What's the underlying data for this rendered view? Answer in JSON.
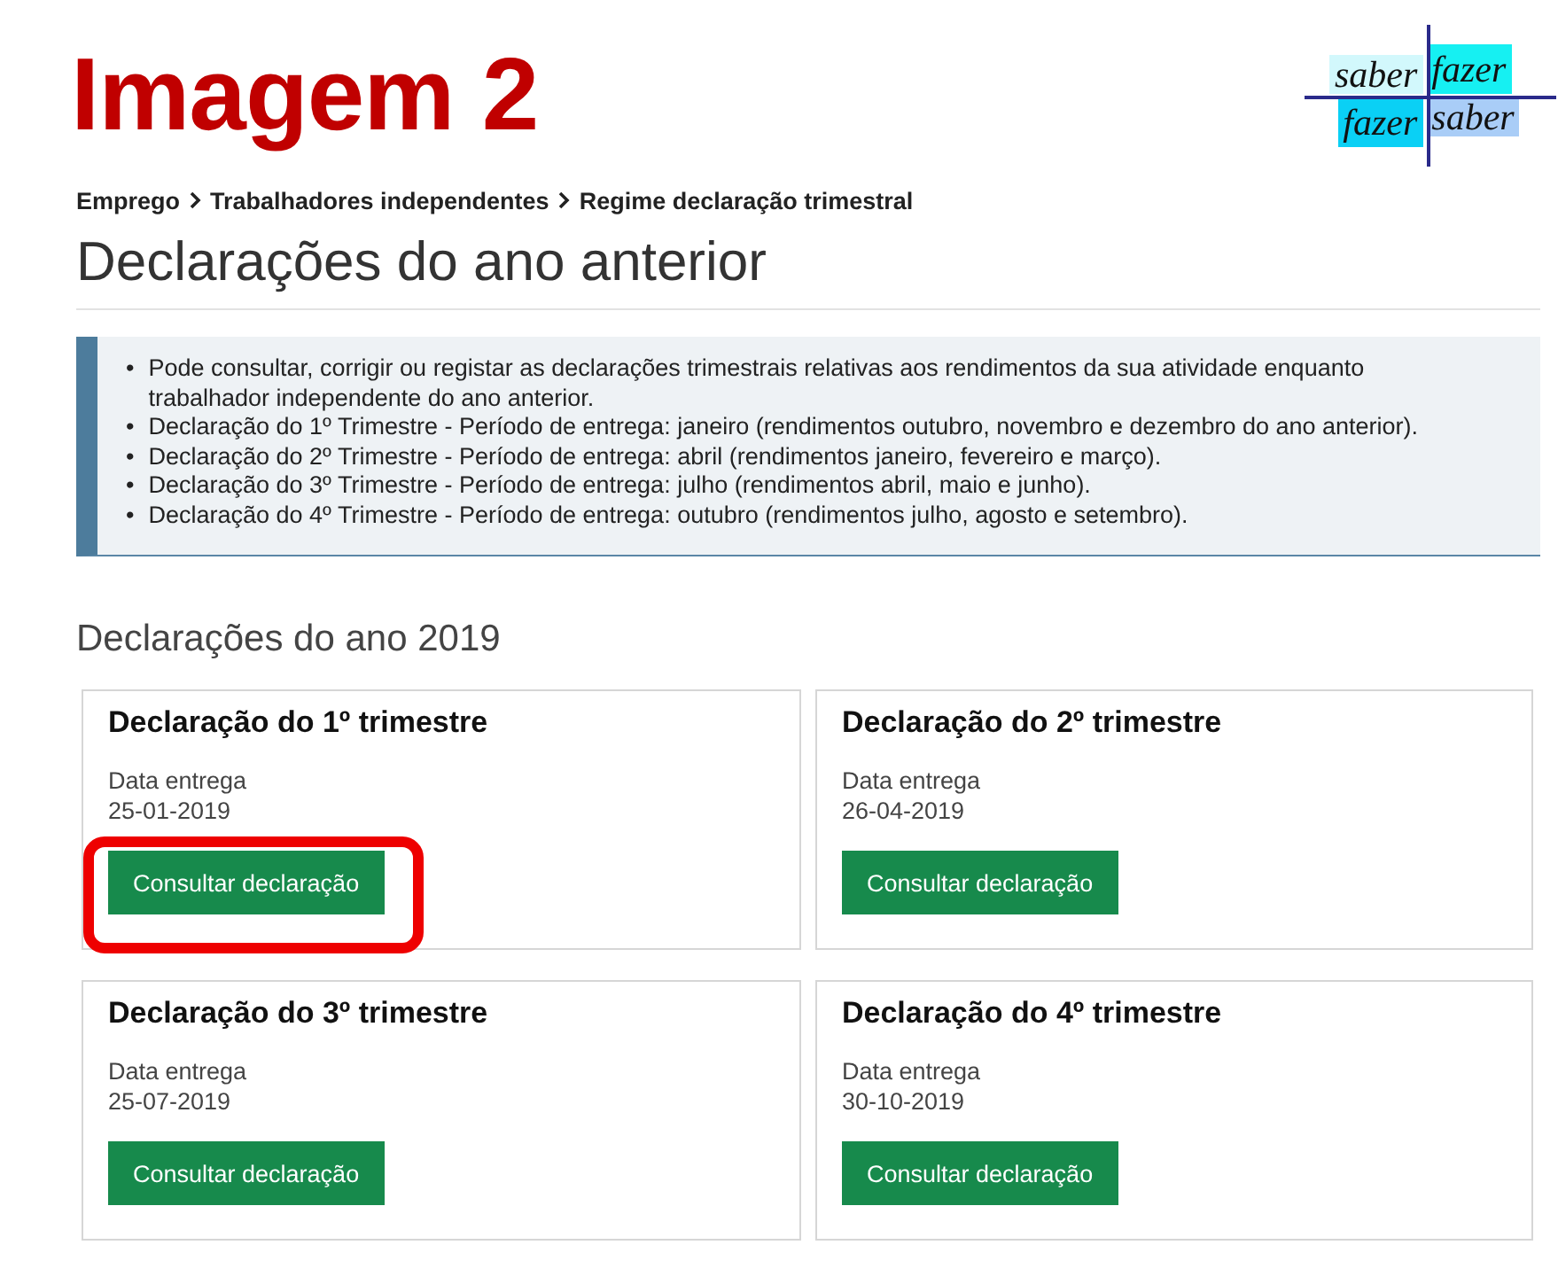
{
  "annotation_title": "Imagem 2",
  "logo": {
    "cells": [
      {
        "text": "saber",
        "color": "#d2f8fc"
      },
      {
        "text": "fazer",
        "color": "#16f0f2"
      },
      {
        "text": "fazer",
        "color": "#0ad0f5"
      },
      {
        "text": "saber",
        "color": "#a9cdf7"
      }
    ]
  },
  "breadcrumb": [
    "Emprego",
    "Trabalhadores independentes",
    "Regime declaração trimestral"
  ],
  "page_title": "Declarações do ano anterior",
  "info_items": [
    {
      "bullet": "•",
      "text": "Pode consultar, corrigir ou registar as declarações trimestrais relativas aos rendimentos da sua atividade enquanto trabalhador independente do ano anterior."
    },
    {
      "bullet": "•",
      "text": "Declaração do 1º Trimestre - Período de entrega: janeiro (rendimentos outubro, novembro e dezembro do ano anterior)."
    },
    {
      "bullet": "•",
      "text": "Declaração do 2º Trimestre - Período de entrega: abril (rendimentos janeiro, fevereiro e março)."
    },
    {
      "bullet": "•",
      "text": "Declaração do 3º Trimestre - Período de entrega: julho (rendimentos abril, maio e junho)."
    },
    {
      "bullet": "•",
      "text": "Declaração do 4º Trimestre - Período de entrega: outubro (rendimentos julho, agosto e setembro)."
    }
  ],
  "section_title": "Declarações do ano 2019",
  "cards": [
    {
      "title": "Declaração do 1º trimestre",
      "date_label": "Data entrega",
      "date": "25-01-2019",
      "button": "Consultar declaração",
      "highlighted": true
    },
    {
      "title": "Declaração do 2º trimestre",
      "date_label": "Data entrega",
      "date": "26-04-2019",
      "button": "Consultar declaração",
      "highlighted": false
    },
    {
      "title": "Declaração do 3º trimestre",
      "date_label": "Data entrega",
      "date": "25-07-2019",
      "button": "Consultar declaração",
      "highlighted": false
    },
    {
      "title": "Declaração do 4º trimestre",
      "date_label": "Data entrega",
      "date": "30-10-2019",
      "button": "Consultar declaração",
      "highlighted": false
    }
  ]
}
